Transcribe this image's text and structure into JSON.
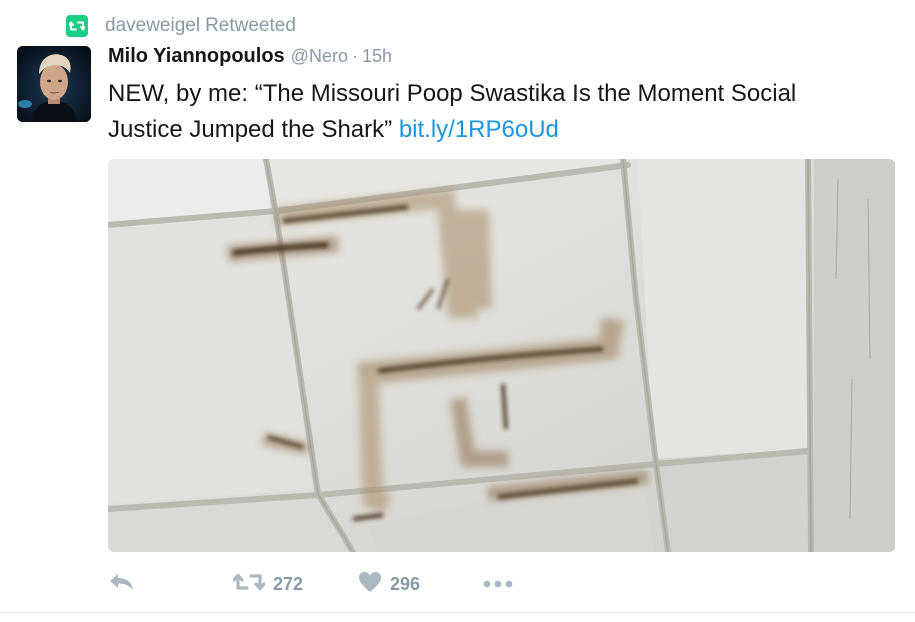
{
  "retweet_context": {
    "user": "daveweigel",
    "label": "Retweeted"
  },
  "tweet": {
    "author_name": "Milo Yiannopoulos",
    "author_handle": "@Nero",
    "separator": "·",
    "timestamp": "15h",
    "text": "NEW, by me: “The Missouri Poop Swastika Is the Moment Social Justice Jumped the Shark”",
    "link": "bit.ly/1RP6oUd"
  },
  "actions": {
    "retweet_count": "272",
    "like_count": "296"
  },
  "icons": {
    "retweet_context": "retweet-icon",
    "reply": "reply-icon",
    "retweet": "retweet-icon",
    "like": "heart-icon",
    "more": "more-icon"
  },
  "colors": {
    "retweet_badge": "#19cf86",
    "link": "#1b95e0",
    "secondary_text": "#8899a6",
    "primary_text": "#14171a"
  }
}
